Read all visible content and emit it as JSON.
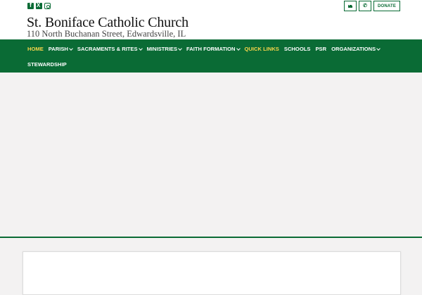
{
  "social": {
    "icons": [
      "facebook-icon",
      "x-icon",
      "instagram-icon"
    ]
  },
  "actions": {
    "email_icon": "envelope-icon",
    "phone_icon": "phone-icon",
    "donate_label": "DONATE"
  },
  "header": {
    "title": "St. Boniface Catholic Church",
    "subtitle": "110 North Buchanan Street, Edwardsville, IL"
  },
  "nav": {
    "items": [
      {
        "label": "HOME",
        "dropdown": false,
        "state": "active"
      },
      {
        "label": "PARISH",
        "dropdown": true
      },
      {
        "label": "SACRAMENTS & RITES",
        "dropdown": true
      },
      {
        "label": "MINISTRIES",
        "dropdown": true
      },
      {
        "label": "FAITH FORMATION",
        "dropdown": true
      },
      {
        "label": "QUICK LINKS",
        "dropdown": false,
        "state": "highlight"
      },
      {
        "label": "SCHOOLS",
        "dropdown": false
      },
      {
        "label": "PSR",
        "dropdown": false
      },
      {
        "label": "ORGANIZATIONS",
        "dropdown": true
      },
      {
        "label": "STEWARDSHIP",
        "dropdown": false
      }
    ]
  },
  "colors": {
    "brand_green": "#0a6b35",
    "nav_highlight": "#f5d54a",
    "hero_background": "#f3f2f2"
  }
}
